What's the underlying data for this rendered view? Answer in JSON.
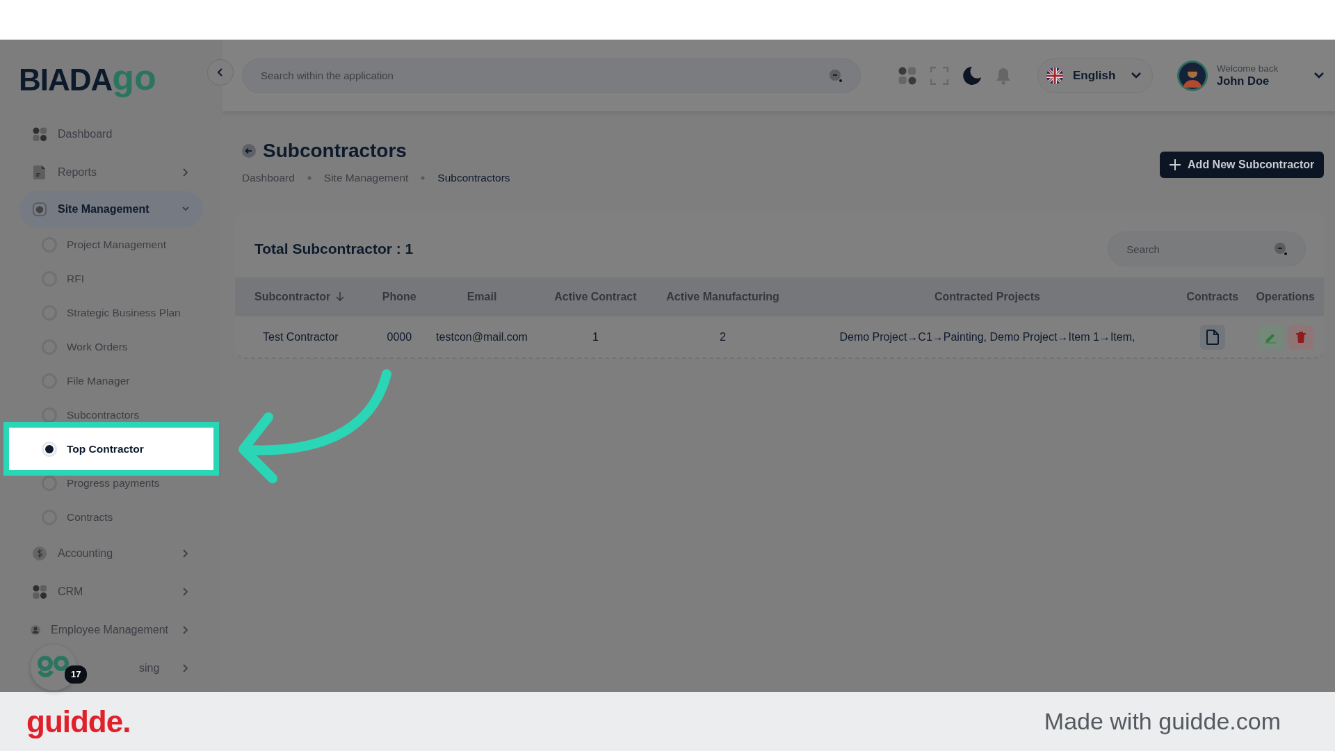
{
  "logo": {
    "text": "BIADA",
    "accent": "go"
  },
  "sidebar": {
    "items": [
      {
        "kind": "link",
        "label": "Dashboard",
        "selected": false
      },
      {
        "kind": "menu",
        "label": "Reports",
        "selected": false,
        "expanded": false
      },
      {
        "kind": "menu",
        "label": "Site Management",
        "selected": true,
        "expanded": true,
        "children": [
          {
            "label": "Project Management",
            "selected": false
          },
          {
            "label": "RFI",
            "selected": false
          },
          {
            "label": "Strategic Business Plan",
            "selected": false
          },
          {
            "label": "Work Orders",
            "selected": false
          },
          {
            "label": "File Manager",
            "selected": false
          },
          {
            "label": "Subcontractors",
            "selected": false
          },
          {
            "label": "Top Contractor",
            "selected": true
          },
          {
            "label": "Progress payments",
            "selected": false
          },
          {
            "label": "Contracts",
            "selected": false
          }
        ]
      },
      {
        "kind": "menu",
        "label": "Accounting",
        "selected": false,
        "expanded": false
      },
      {
        "kind": "menu",
        "label": "CRM",
        "selected": false,
        "expanded": false
      },
      {
        "kind": "menu",
        "label": "Employee Management",
        "selected": false,
        "expanded": false
      },
      {
        "kind": "menu",
        "label": "sing",
        "selected": false,
        "expanded": false
      }
    ]
  },
  "help_bubble": {
    "badge": "17"
  },
  "header": {
    "search": {
      "placeholder": "Search within the application"
    },
    "language": "English",
    "greeting": "Welcome back",
    "user": "John Doe"
  },
  "page": {
    "title": "Subcontractors",
    "breadcrumbs": [
      {
        "label": "Dashboard",
        "selected": false
      },
      {
        "label": "Site Management",
        "selected": false
      },
      {
        "label": "Subcontractors",
        "selected": true
      }
    ],
    "add_button": "Add New Subcontractor"
  },
  "card": {
    "title": "Total Subcontractor : 1",
    "search": {
      "placeholder": "Search"
    },
    "table": {
      "columns": [
        {
          "label": "Subcontractor",
          "sorted": true
        },
        {
          "label": "Phone",
          "sorted": false
        },
        {
          "label": "Email",
          "sorted": false
        },
        {
          "label": "Active Contract",
          "sorted": false
        },
        {
          "label": "Active Manufacturing",
          "sorted": false
        },
        {
          "label": "Contracted Projects",
          "sorted": false
        },
        {
          "label": "Contracts",
          "sorted": false
        },
        {
          "label": "Operations",
          "sorted": false
        }
      ],
      "rows": [
        {
          "cells": [
            "Test Contractor",
            "0000",
            "testcon@mail.com",
            "1",
            "2",
            "Demo Project→C1→Painting, Demo Project→Item 1→Item,"
          ]
        }
      ]
    }
  },
  "footer": {
    "brand": "guidde.",
    "note": "Made with guidde.com"
  }
}
